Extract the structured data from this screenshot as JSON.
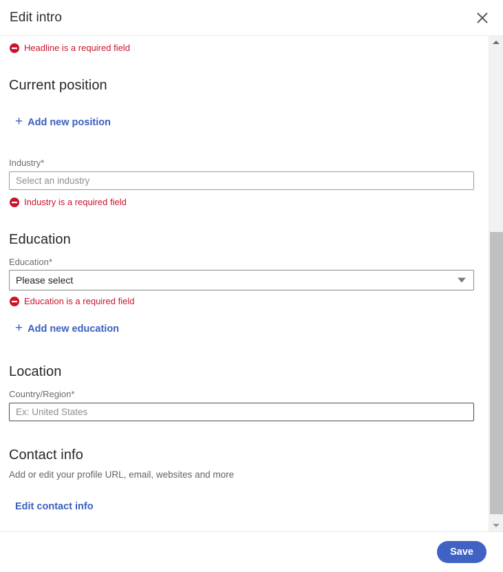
{
  "dialog": {
    "title": "Edit intro",
    "close_icon": "close-icon"
  },
  "errors": {
    "headline": "Headline is a required field",
    "industry": "Industry is a required field",
    "education": "Education is a required field"
  },
  "sections": {
    "current_position": {
      "heading": "Current position",
      "add_link": "Add new position",
      "add_icon": "plus-icon",
      "industry_label": "Industry*",
      "industry_value": "",
      "industry_placeholder": "Select an industry"
    },
    "education": {
      "heading": "Education",
      "label": "Education*",
      "selected": "Please select",
      "dropdown_icon": "chevron-down-icon",
      "add_link": "Add new education",
      "add_icon": "plus-icon"
    },
    "location": {
      "heading": "Location",
      "label": "Country/Region*",
      "value": "",
      "placeholder": "Ex: United States"
    },
    "contact_info": {
      "heading": "Contact info",
      "description": "Add or edit your profile URL, email, websites and more",
      "edit_link": "Edit contact info"
    }
  },
  "scrollbar": {
    "up_icon": "scroll-up-arrow-icon",
    "down_icon": "scroll-down-arrow-icon"
  },
  "footer": {
    "save_label": "Save"
  },
  "colors": {
    "accent_blue": "#3f62c4",
    "error_red": "#c9142b",
    "link_blue": "#3b5fc0",
    "scrollbar_thumb": "#c0c0c0"
  }
}
